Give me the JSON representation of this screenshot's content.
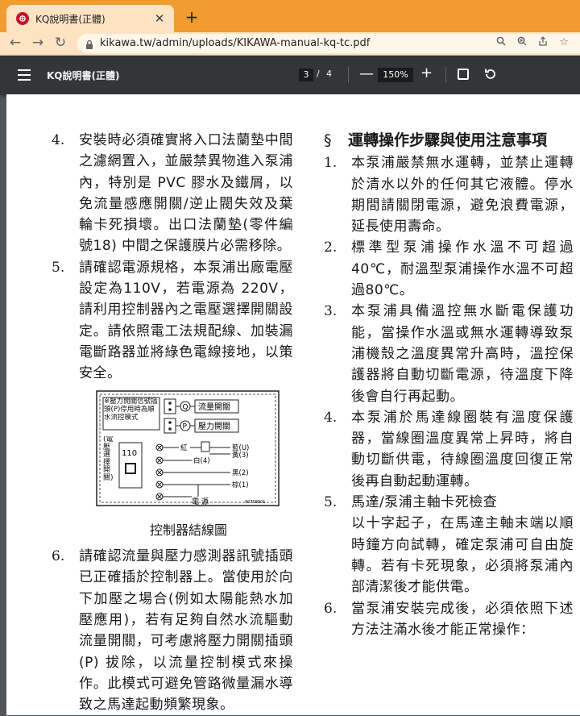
{
  "browser": {
    "tab_title": "KQ說明書(正體)",
    "tab_close": "✕",
    "new_tab": "+",
    "url": "kikawa.tw/admin/uploads/KIKAWA-manual-kq-tc.pdf",
    "icons": [
      "back-icon",
      "forward-icon",
      "reload-icon",
      "lock-icon",
      "search-icon",
      "zoom-icon",
      "share-icon",
      "bookmark-star-icon"
    ]
  },
  "pdf_toolbar": {
    "title": "KQ說明書(正體)",
    "page_current": "3",
    "page_sep": "/",
    "page_total": "4",
    "zoom": "150%",
    "zoom_minus": "—",
    "zoom_plus": "+"
  },
  "left": {
    "item4_num": "4.",
    "item4_text": "安裝時必須確實將入口法蘭墊中間之濾網置入，並嚴禁異物進入泵浦內，特別是 PVC 膠水及鐵屑，以免流量感應開關/逆止閥失效及葉輪卡死損壞。出口法蘭墊(零件編號18) 中間之保護膜片必需移除。",
    "item5_num": "5.",
    "item5_text": "請確認電源規格，本泵浦出廠電壓設定為110V，若電源為 220V，請利用控制器內之電壓選擇開關設定。請依照電工法規配線、加裝漏電斷路器並將綠色電線接地，以策安全。",
    "diagram": {
      "box1_label": "※壓力開關信號插頭(P)停用時為順水流控模式",
      "flow_switch": "流量開關",
      "pressure_switch": "壓力開關",
      "q_mark": "Q",
      "p_mark": "P",
      "voltage_label": "(電壓選擇開關)",
      "voltage_value": "110",
      "red": "紅",
      "blue": "藍(U)",
      "yellow": "黃(3)",
      "white": "白(4)",
      "black": "黑(2)",
      "brown": "棕(1)",
      "power": "電 源",
      "code": "90709001",
      "caption": "控制器結線圖"
    },
    "item6_num": "6.",
    "item6_text": "請確認流量與壓力感測器訊號插頭已正確插於控制器上。當使用於向下加壓之場合(例如太陽能熱水加壓應用)，若有足夠自然水流驅動流量開關，可考慮將壓力開關插頭 (P) 拔除，以流量控制模式來操作。此模式可避免管路微量漏水導致之馬達起動頻繁現象。"
  },
  "right": {
    "section_mark": "§",
    "section_title": "運轉操作步驟與使用注意事項",
    "item1_num": "1.",
    "item1_text": "本泵浦嚴禁無水運轉，並禁止運轉於清水以外的任何其它液體。停水期間請關閉電源，避免浪費電源，延長使用壽命。",
    "item2_num": "2.",
    "item2_text": "標準型泵浦操作水溫不可超過 40℃，耐溫型泵浦操作水溫不可超過80℃。",
    "item3_num": "3.",
    "item3_text": "本泵浦具備溫控無水斷電保護功能，當操作水溫或無水運轉導致泵浦機殼之溫度異常升高時，溫控保護器將自動切斷電源，待溫度下降後會自行再起動。",
    "item4_num": "4.",
    "item4_text": "本泵浦於馬達線圈裝有溫度保護器，當線圈溫度異常上昇時，將自動切斷供電，待線圈溫度回復正常後再自動起動運轉。",
    "item5_num": "5.",
    "item5_title": "馬達/泵浦主軸卡死檢查",
    "item5_text": "以十字起子，在馬達主軸末端以順時鐘方向試轉，確定泵浦可自由旋轉。若有卡死現象，必須將泵浦內部清潔後才能供電。",
    "item6_num": "6.",
    "item6_text": "當泵浦安裝完成後，必須依照下述方法注滿水後才能正常操作："
  }
}
